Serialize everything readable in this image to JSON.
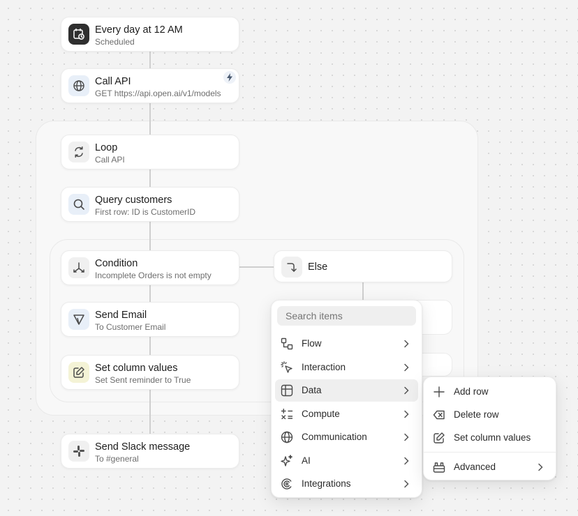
{
  "nodes": {
    "schedule": {
      "title": "Every day at 12 AM",
      "subtitle": "Scheduled",
      "icon": "calendar-clock-icon"
    },
    "call_api": {
      "title": "Call API",
      "subtitle": "GET https://api.open.ai/v1/models",
      "icon": "globe-icon",
      "badge_icon": "lightning-icon"
    },
    "loop": {
      "title": "Loop",
      "subtitle": "Call API",
      "icon": "loop-icon"
    },
    "query": {
      "title": "Query customers",
      "subtitle": "First row: ID is CustomerID",
      "icon": "search-icon"
    },
    "condition": {
      "title": "Condition",
      "subtitle": "Incomplete Orders is not empty",
      "icon": "branch-icon"
    },
    "else": {
      "title": "Else",
      "icon": "turn-down-icon"
    },
    "send_email": {
      "title": "Send Email",
      "subtitle": "To Customer Email",
      "icon": "send-icon"
    },
    "set_column": {
      "title": "Set column values",
      "subtitle": "Set Sent reminder to True",
      "icon": "edit-icon"
    },
    "slack": {
      "title": "Send Slack message",
      "subtitle": "To #general",
      "icon": "slack-icon"
    }
  },
  "menu": {
    "search_placeholder": "Search items",
    "items": [
      {
        "label": "Flow",
        "icon": "flow-icon"
      },
      {
        "label": "Interaction",
        "icon": "pointer-click-icon"
      },
      {
        "label": "Data",
        "icon": "table-icon",
        "active": true
      },
      {
        "label": "Compute",
        "icon": "calculator-icon"
      },
      {
        "label": "Communication",
        "icon": "globe-icon"
      },
      {
        "label": "AI",
        "icon": "sparkle-icon"
      },
      {
        "label": "Integrations",
        "icon": "integrations-icon"
      }
    ]
  },
  "submenu": {
    "items": [
      {
        "label": "Add row",
        "icon": "plus-icon"
      },
      {
        "label": "Delete row",
        "icon": "backspace-icon"
      },
      {
        "label": "Set column values",
        "icon": "edit-icon"
      },
      {
        "label": "Advanced",
        "icon": "toolbox-icon"
      }
    ]
  },
  "colors": {
    "canvas": "#f3f3f3",
    "node_bg": "#ffffff",
    "connector": "#cfcfcf",
    "active_item": "#efefef"
  }
}
